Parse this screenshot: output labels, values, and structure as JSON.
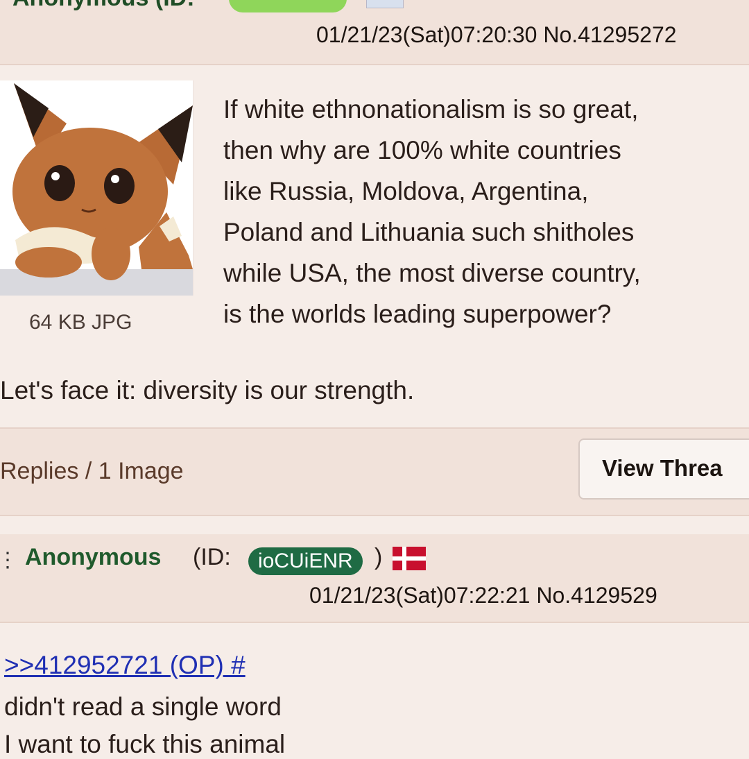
{
  "op": {
    "name": "Anonymous (ID: ",
    "date_no": "01/21/23(Sat)07:20:30 No.41295272",
    "file_info": "64 KB JPG",
    "image_icon": "eevee-thumbnail",
    "text": "If white ethnonationalism is so great,\nthen why are 100% white countries\nlike Russia, Moldova, Argentina,\nPoland and Lithuania such shitholes\nwhile USA, the most diverse country,\nis the worlds leading superpower?",
    "text2": "Let's face it: diversity is our strength."
  },
  "thread_bar": {
    "replies": "Replies / 1 Image",
    "view_button": "View Threa"
  },
  "reply": {
    "name": "Anonymous",
    "id_label": "(ID: ",
    "id": "ioCUiENR",
    "paren_close": ")",
    "flag": "denmark-flag",
    "date_no": "01/21/23(Sat)07:22:21 No.4129529",
    "quote": ">>412952721 (OP) #",
    "line1": "didn't read a single word",
    "line2": "I want to fuck this animal"
  },
  "colors": {
    "background": "#f6ede8",
    "header": "#f1e2da",
    "name_green": "#1f5a2c",
    "id_badge": "#1f6b44",
    "quote_link": "#1f2fb3"
  }
}
